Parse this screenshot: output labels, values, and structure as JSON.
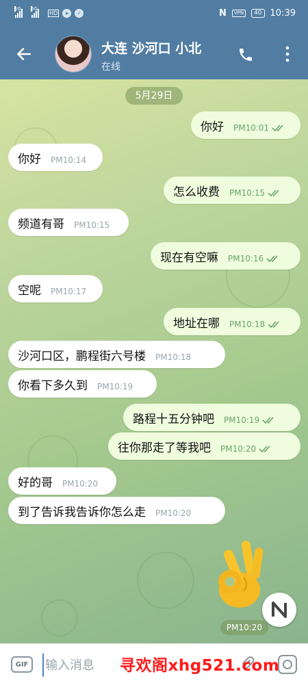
{
  "status": {
    "carrier1": "5G",
    "carrier2": "5G",
    "hd": "HD",
    "vpn": "VPN",
    "battery": "40",
    "time": "10:39"
  },
  "header": {
    "title": "大连 沙河口 小北",
    "subtitle": "在线"
  },
  "date_pill": "5月29日",
  "messages": [
    {
      "dir": "out",
      "text": "你好",
      "time": "PM10:01",
      "read": true
    },
    {
      "dir": "in",
      "text": "你好",
      "time": "PM10:14"
    },
    {
      "dir": "out",
      "text": "怎么收费",
      "time": "PM10:15",
      "read": true
    },
    {
      "dir": "in",
      "text": "频道有哥",
      "time": "PM10:15"
    },
    {
      "dir": "out",
      "text": "现在有空嘛",
      "time": "PM10:16",
      "read": true
    },
    {
      "dir": "in",
      "text": "空呢",
      "time": "PM10:17"
    },
    {
      "dir": "out",
      "text": "地址在哪",
      "time": "PM10:18",
      "read": true
    },
    {
      "dir": "in",
      "text": "沙河口区，鹏程街六号楼",
      "time": "PM10:18"
    },
    {
      "dir": "in",
      "text": "你看下多久到",
      "time": "PM10:19"
    },
    {
      "dir": "out",
      "text": "路程十五分钟吧",
      "time": "PM10:19",
      "read": true
    },
    {
      "dir": "out",
      "text": "往你那走了等我吧",
      "time": "PM10:20",
      "read": true
    },
    {
      "dir": "in",
      "text": "好的哥",
      "time": "PM10:20"
    },
    {
      "dir": "in",
      "text": "到了告诉我告诉你怎么走",
      "time": "PM10:20"
    }
  ],
  "sticker": {
    "icon": "ok-hand-sticker",
    "time": "PM10:20"
  },
  "input": {
    "gif_label": "GIF",
    "placeholder": "输入消息",
    "watermark": "寻欢阁xhg521.com"
  }
}
